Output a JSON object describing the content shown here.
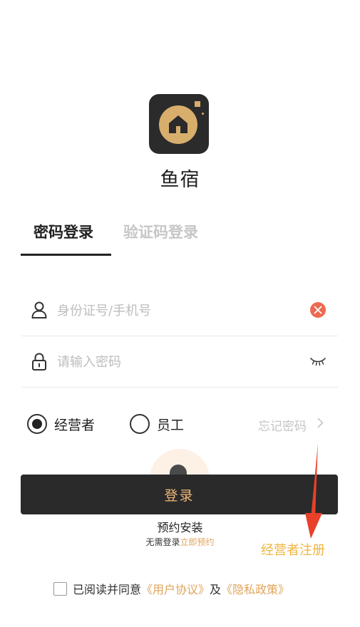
{
  "app": {
    "name": "鱼宿"
  },
  "tabs": [
    {
      "label": "密码登录",
      "active": true
    },
    {
      "label": "验证码登录",
      "active": false
    }
  ],
  "form": {
    "user_placeholder": "身份证号/手机号",
    "user_value": "",
    "password_placeholder": "请输入密码",
    "password_value": ""
  },
  "roles": [
    {
      "label": "经营者",
      "selected": true
    },
    {
      "label": "员工",
      "selected": false
    }
  ],
  "forgot_label": "忘记密码",
  "login_label": "登录",
  "preinstall_label": "预约安装",
  "no_register": {
    "text": "无需登录",
    "link": "立即预约"
  },
  "annotation": {
    "text": "经营者注册"
  },
  "agreement": {
    "prefix": "已阅读并同意",
    "user_agreement": "《用户协议》",
    "conjunction": "及",
    "privacy_policy": "《隐私政策》"
  },
  "colors": {
    "accent_gold": "#e0a55c",
    "button_bg": "#2a2a2a",
    "clear_red": "#ec6a52",
    "annotation_red": "#e8402a"
  },
  "icons": {
    "logo": "house-icon",
    "user": "user-icon",
    "lock": "lock-icon",
    "clear": "clear-icon",
    "eye": "eye-closed-icon",
    "chevron": "chevron-right-icon"
  }
}
